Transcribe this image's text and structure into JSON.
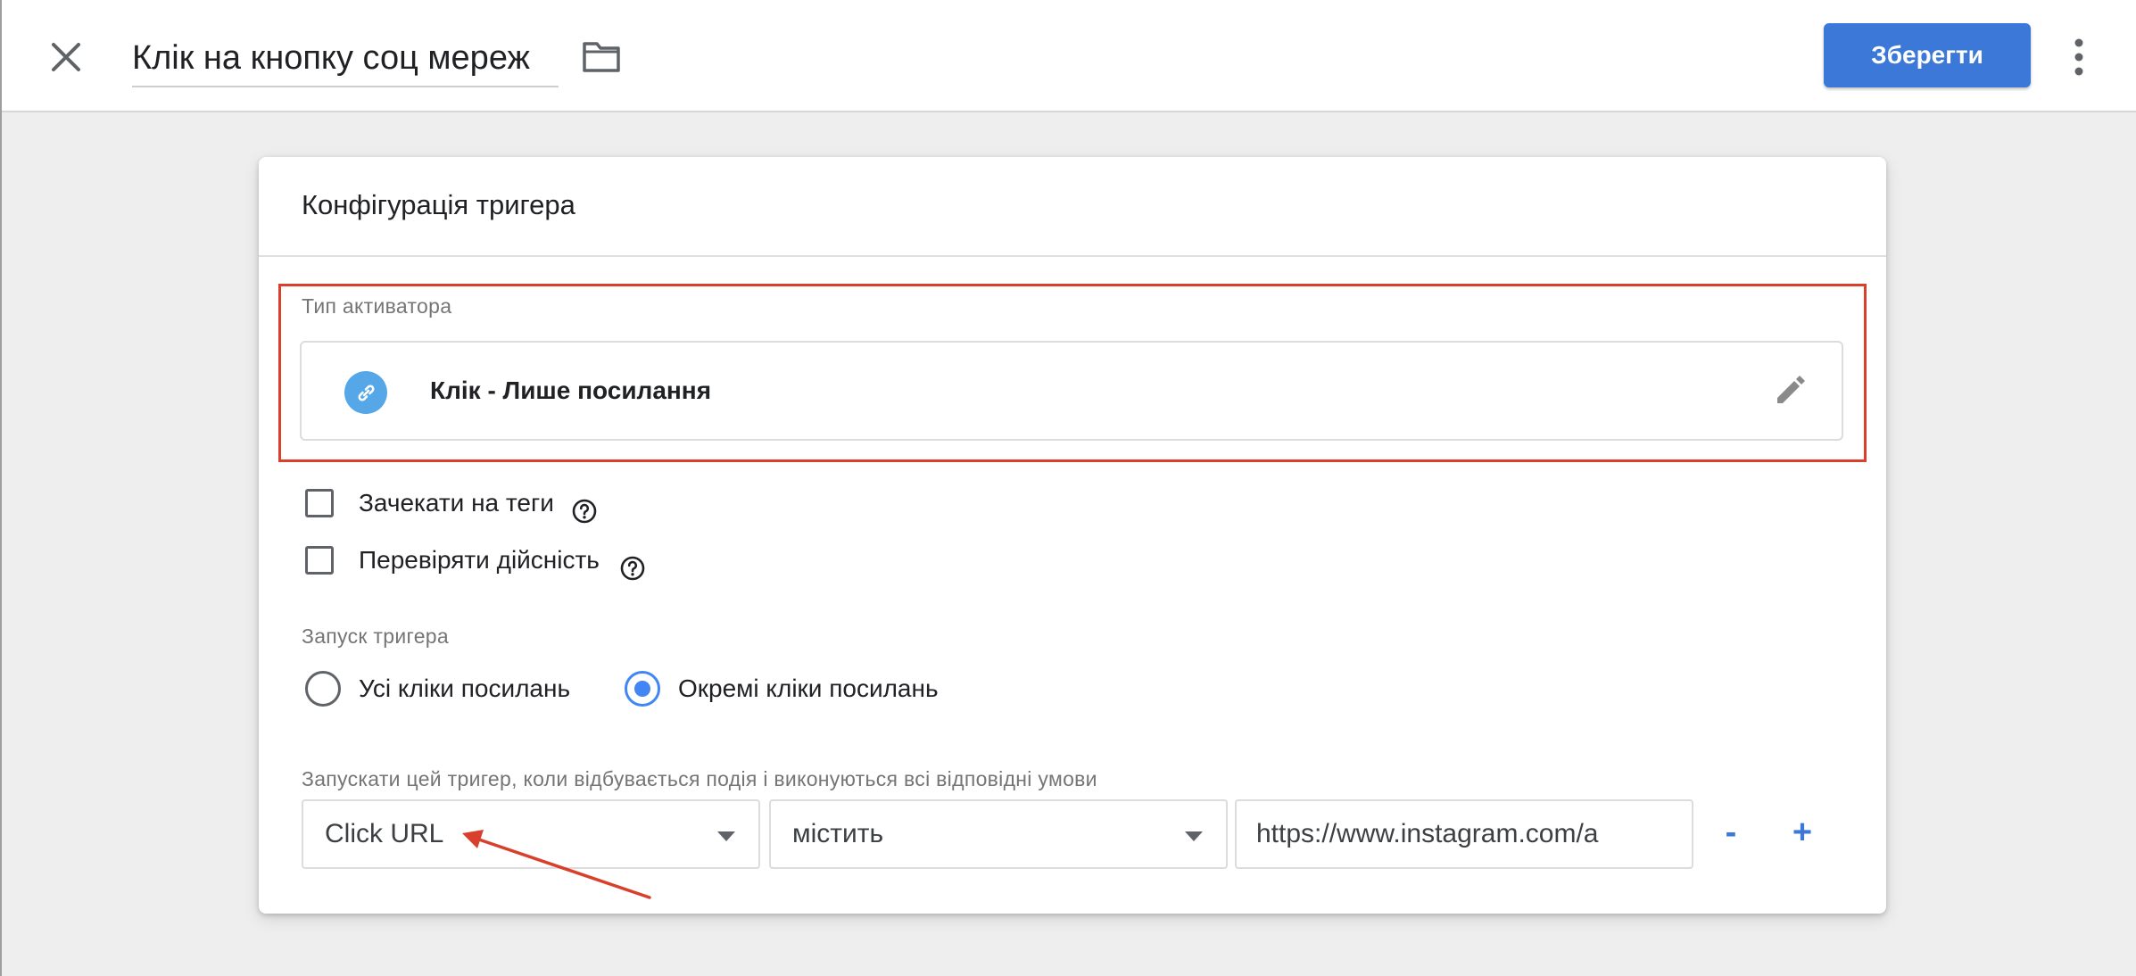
{
  "header": {
    "title": "Клік на кнопку соц мереж",
    "save_label": "Зберегти"
  },
  "card": {
    "title": "Конфігурація тригера",
    "trigger_type": {
      "section_label": "Тип активатора",
      "value": "Клік - Лише посилання"
    },
    "options": [
      {
        "label": "Зачекати на теги",
        "checked": false
      },
      {
        "label": "Перевіряти дійсність",
        "checked": false
      }
    ],
    "firing": {
      "section_label": "Запуск тригера",
      "choices": [
        {
          "label": "Усі кліки посилань",
          "selected": false
        },
        {
          "label": "Окремі кліки посилань",
          "selected": true
        }
      ]
    },
    "condition": {
      "label": "Запускати цей тригер, коли відбувається подія і виконуються всі відповідні умови",
      "variable": "Click URL",
      "operator": "містить",
      "value": "https://www.instagram.com/a",
      "remove_label": "-",
      "add_label": "+"
    }
  },
  "colors": {
    "accent": "#3c78d8",
    "highlight_border": "#d9402c",
    "radio_selected": "#4285f4",
    "link_icon_bg": "#55a7e8"
  },
  "icons": [
    "close-icon",
    "folder-icon",
    "more-vert-icon",
    "link-icon",
    "edit-pencil-icon",
    "help-icon",
    "arrow-annotation"
  ]
}
